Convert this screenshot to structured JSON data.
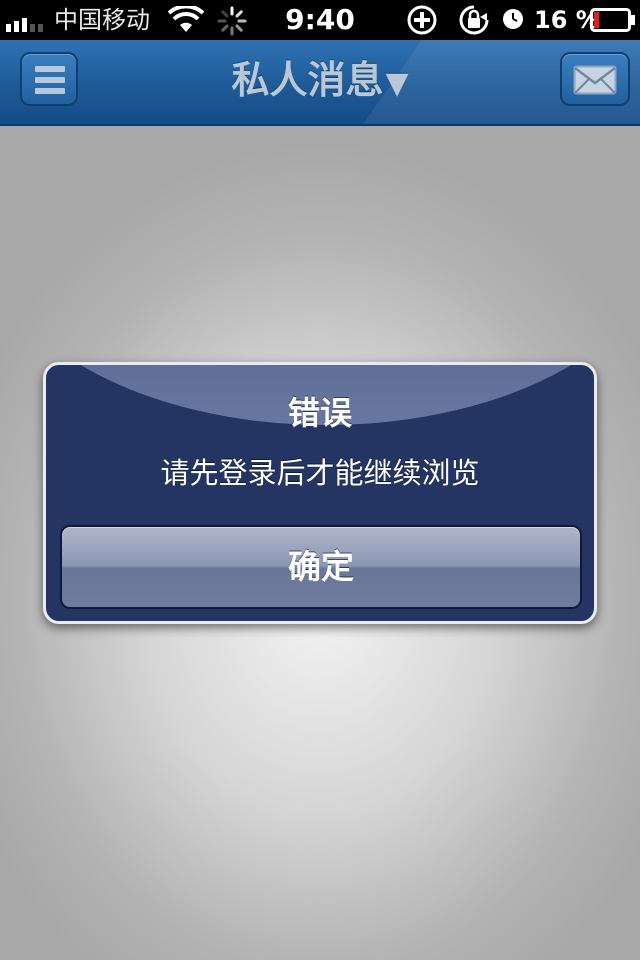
{
  "status_bar": {
    "carrier": "中国移动",
    "time": "9:40",
    "battery_percent": "16 %",
    "battery_level": 0.16,
    "icons": [
      "signal-bars-icon",
      "wifi-icon",
      "activity-spinner-icon",
      "plus-circle-icon",
      "rotation-lock-icon",
      "alarm-clock-icon",
      "battery-icon"
    ]
  },
  "nav_bar": {
    "title": "私人消息",
    "caret": "▼",
    "left_icon": "menu-icon",
    "right_icon": "envelope-icon",
    "color": "#1e5a98"
  },
  "alert": {
    "title": "错误",
    "message": "请先登录后才能继续浏览",
    "button_label": "确定",
    "color": "#243463"
  }
}
